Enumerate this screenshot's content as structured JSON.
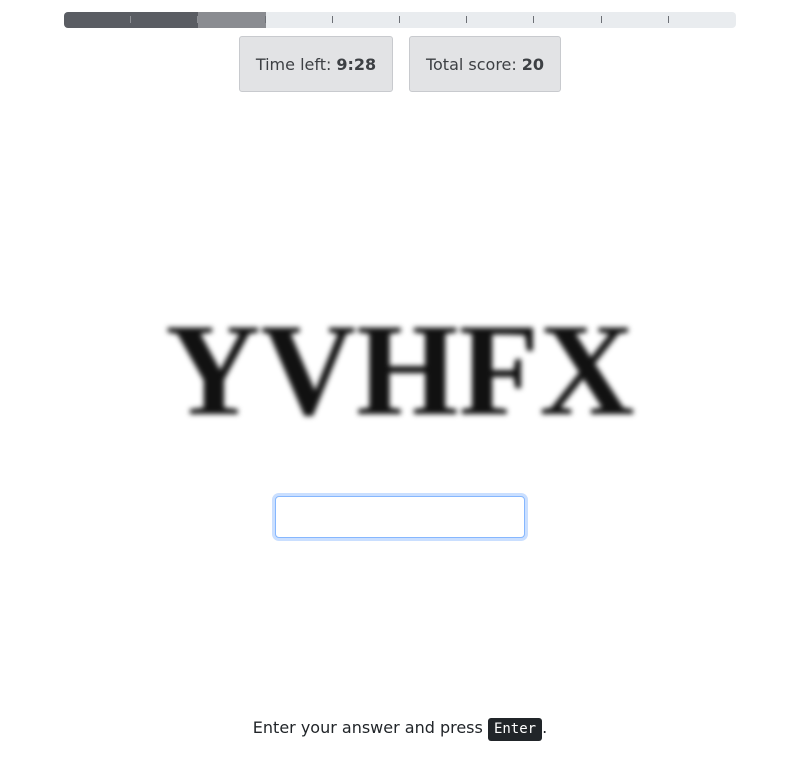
{
  "progress": {
    "total_steps": 10,
    "completed_steps": 2,
    "current_step": 3
  },
  "stats": {
    "time_label": "Time left:",
    "time_value": "9:28",
    "score_label": "Total score:",
    "score_value": "20"
  },
  "captcha": {
    "text": "YVHFX"
  },
  "answer": {
    "value": "",
    "placeholder": ""
  },
  "instruction": {
    "text_before": "Enter your answer and press",
    "key": "Enter",
    "text_after": "."
  },
  "colors": {
    "progress_done": "#5a5d63",
    "progress_current": "#8a8c91",
    "progress_track": "#e9ecef",
    "stat_bg": "#e2e3e5",
    "input_focus": "#86b7fe"
  }
}
